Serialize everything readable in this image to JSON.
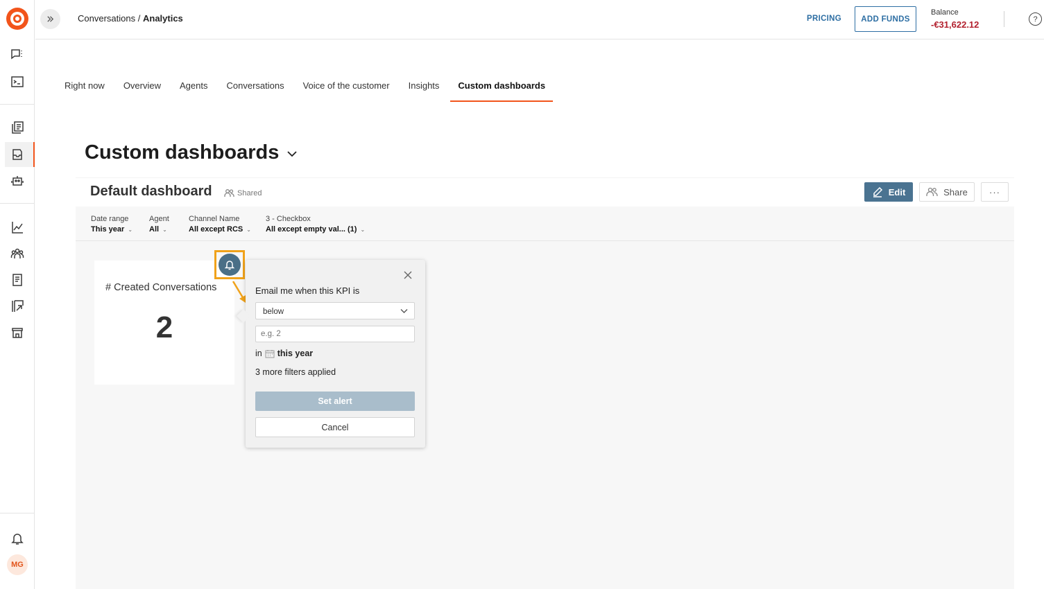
{
  "topbar": {
    "breadcrumb_parent": "Conversations",
    "breadcrumb_separator": "/",
    "breadcrumb_current": "Analytics",
    "pricing_label": "PRICING",
    "add_funds_label": "ADD FUNDS",
    "balance_label": "Balance",
    "balance_value": "-€31,622.12",
    "help_label": "?"
  },
  "sidebar": {
    "avatar_initials": "MG",
    "items": [
      {
        "icon": "chat-list-icon"
      },
      {
        "icon": "terminal-icon"
      },
      {
        "icon": "documents-icon"
      },
      {
        "icon": "inbox-icon",
        "active": true
      },
      {
        "icon": "bot-icon"
      },
      {
        "icon": "analytics-chart-icon"
      },
      {
        "icon": "people-icon"
      },
      {
        "icon": "notebook-icon"
      },
      {
        "icon": "export-icon"
      },
      {
        "icon": "store-icon"
      },
      {
        "icon": "bell-icon"
      }
    ]
  },
  "tabs": [
    {
      "label": "Right now"
    },
    {
      "label": "Overview"
    },
    {
      "label": "Agents"
    },
    {
      "label": "Conversations"
    },
    {
      "label": "Voice of the customer"
    },
    {
      "label": "Insights"
    },
    {
      "label": "Custom dashboards",
      "active": true
    }
  ],
  "page": {
    "title": "Custom dashboards"
  },
  "dashboard": {
    "title": "Default dashboard",
    "shared_label": "Shared",
    "edit_label": "Edit",
    "share_label": "Share",
    "more_label": "···",
    "filters": [
      {
        "label": "Date range",
        "value": "This year"
      },
      {
        "label": "Agent",
        "value": "All"
      },
      {
        "label": "Channel Name",
        "value": "All except RCS"
      },
      {
        "label": "3 - Checkbox",
        "value": "All except empty val... (1)"
      }
    ]
  },
  "widget": {
    "title": "# Created Conversations",
    "value": "2"
  },
  "alert_popover": {
    "label": "Email me when this KPI is",
    "condition_value": "below",
    "threshold_placeholder": "e.g. 2",
    "in_prefix": "in",
    "period": "this year",
    "filters_note": "3 more filters applied",
    "set_alert_label": "Set alert",
    "cancel_label": "Cancel"
  },
  "colors": {
    "brand_orange": "#f2541b",
    "link_blue": "#2d6ea3",
    "balance_red": "#b21f2d",
    "edit_button": "#4a7391",
    "highlight": "#f0a21a"
  }
}
